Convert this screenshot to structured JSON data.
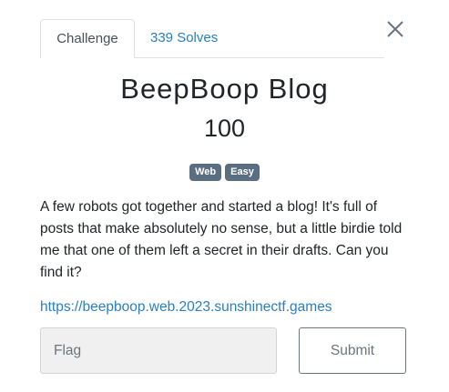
{
  "tabs": [
    {
      "label": "Challenge",
      "active": true
    },
    {
      "label": "339 Solves",
      "active": false
    }
  ],
  "challenge": {
    "title": "BeepBoop Blog",
    "points": "100",
    "tags": [
      "Web",
      "Easy"
    ],
    "description": "A few robots got together and started a blog! It's full of posts that make absolutely no sense, but a little birdie told me that one of them left a secret in their drafts. Can you find it?",
    "link": "https://beepboop.web.2023.sunshinectf.games"
  },
  "form": {
    "flag_placeholder": "Flag",
    "flag_value": "",
    "submit_label": "Submit"
  },
  "colors": {
    "link": "#2a7fbf",
    "tag_bg": "#5a6e82",
    "input_bg": "#f0f0f0"
  },
  "icons": {
    "close": "close-icon"
  }
}
